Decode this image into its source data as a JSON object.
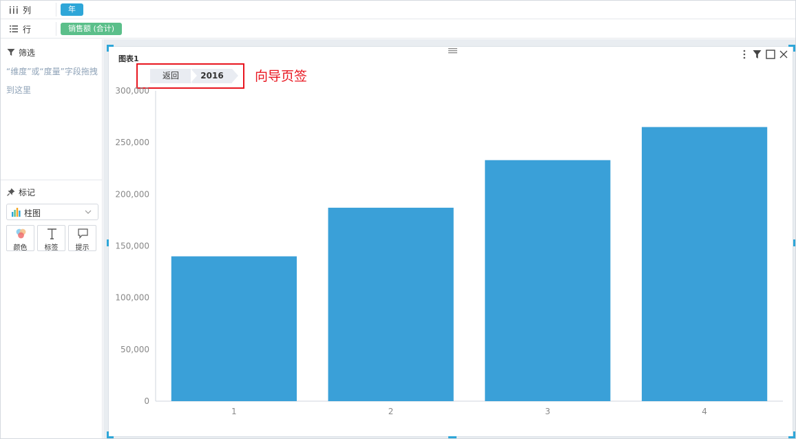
{
  "shelves": {
    "columns": {
      "label": "列",
      "pill": "年"
    },
    "rows": {
      "label": "行",
      "pill": "销售额 (合计)"
    }
  },
  "filter": {
    "title": "筛选",
    "hint": "“维度”或“度量”字段拖拽到这里"
  },
  "marks": {
    "title": "标记",
    "chart_type": "柱图",
    "buttons": [
      {
        "label": "颜色",
        "icon": "color-icon"
      },
      {
        "label": "标签",
        "icon": "text-label-icon"
      },
      {
        "label": "提示",
        "icon": "tooltip-icon"
      }
    ]
  },
  "chart": {
    "title": "图表1",
    "breadcrumb": {
      "back": "返回",
      "current": "2016"
    },
    "annotation": "向导页签"
  },
  "colors": {
    "bar": "#3aa0d8",
    "accent": "#2ea6d8",
    "annotation_red": "#e8141e",
    "pill_green": "#5bbf8a"
  },
  "chart_data": {
    "type": "bar",
    "title": "图表1",
    "categories": [
      "1",
      "2",
      "3",
      "4"
    ],
    "values": [
      140000,
      187000,
      233000,
      265000
    ],
    "yticks": [
      "0",
      "50,000",
      "100,000",
      "150,000",
      "200,000",
      "250,000",
      "300,000"
    ],
    "ylim": [
      0,
      300000
    ],
    "xlabel": "",
    "ylabel": "",
    "grid": false,
    "legend": "none"
  }
}
